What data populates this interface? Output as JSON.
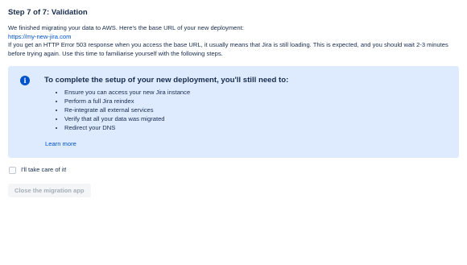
{
  "step": {
    "title": "Step 7 of 7: Validation"
  },
  "intro": {
    "line1": "We finished migrating your data to AWS. Here's the base URL of your new deployment:",
    "url": "https://my-new-jira.com",
    "line2": "If you get an HTTP Error 503 response when you access the base URL, it usually means that Jira is still loading. This is expected, and you should wait 2-3 minutes before trying again. Use this time to familiarise yourself with the following steps."
  },
  "info_panel": {
    "icon": "info-icon",
    "heading": "To complete the setup of your new deployment, you'll still need to:",
    "items": [
      "Ensure you can access your new Jira instance",
      "Perform a full Jira reindex",
      "Re-integrate all external services",
      "Verify that all your data was migrated",
      "Redirect your DNS"
    ],
    "learn_more": "Learn more",
    "background_color": "#deebff",
    "icon_color": "#0052cc"
  },
  "confirm": {
    "checkbox_label": "I'll take care of it!",
    "checked": false
  },
  "actions": {
    "close_label": "Close the migration app",
    "close_disabled": true
  },
  "colors": {
    "link": "#0052cc",
    "text": "#172b4d"
  }
}
